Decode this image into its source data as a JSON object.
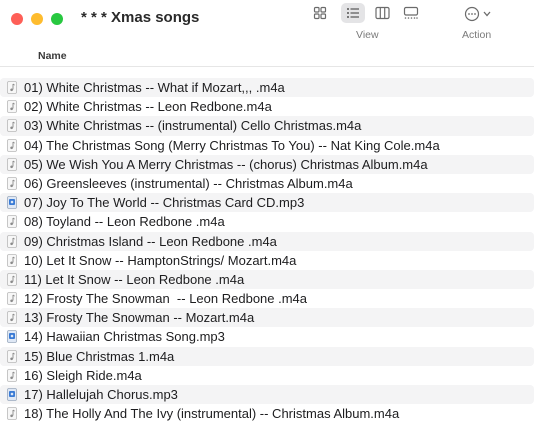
{
  "window": {
    "title": "* * * Xmas songs"
  },
  "toolbar": {
    "view_label": "View",
    "action_label": "Action"
  },
  "columns": {
    "name": "Name"
  },
  "files": [
    {
      "name": "01) White Christmas -- What if Mozart,,, .m4a",
      "kind": "m4a"
    },
    {
      "name": "02) White Christmas -- Leon Redbone.m4a",
      "kind": "m4a"
    },
    {
      "name": "03) White Christmas -- (instrumental) Cello Christmas.m4a",
      "kind": "m4a"
    },
    {
      "name": "04) The Christmas Song (Merry Christmas To You) -- Nat King Cole.m4a",
      "kind": "m4a"
    },
    {
      "name": "05) We Wish You A Merry Christmas -- (chorus) Christmas Album.m4a",
      "kind": "m4a"
    },
    {
      "name": "06) Greensleeves (instrumental) -- Christmas Album.m4a",
      "kind": "m4a"
    },
    {
      "name": "07) Joy To The World -- Christmas Card CD.mp3",
      "kind": "mp3"
    },
    {
      "name": "08) Toyland -- Leon Redbone .m4a",
      "kind": "m4a"
    },
    {
      "name": "09) Christmas Island -- Leon Redbone .m4a",
      "kind": "m4a"
    },
    {
      "name": "10) Let It Snow -- HamptonStrings/ Mozart.m4a",
      "kind": "m4a"
    },
    {
      "name": "11) Let It Snow -- Leon Redbone .m4a",
      "kind": "m4a"
    },
    {
      "name": "12) Frosty The Snowman  -- Leon Redbone .m4a",
      "kind": "m4a"
    },
    {
      "name": "13) Frosty The Snowman -- Mozart.m4a",
      "kind": "m4a"
    },
    {
      "name": "14) Hawaiian Christmas Song.mp3",
      "kind": "mp3"
    },
    {
      "name": "15) Blue Christmas 1.m4a",
      "kind": "m4a"
    },
    {
      "name": "16) Sleigh Ride.m4a",
      "kind": "m4a"
    },
    {
      "name": "17) Hallelujah Chorus.mp3",
      "kind": "mp3"
    },
    {
      "name": "18) The Holly And The Ivy (instrumental) -- Christmas Album.m4a",
      "kind": "m4a"
    }
  ],
  "colors": {
    "close": "#fe5f57",
    "minimize": "#febc2e",
    "zoom": "#28c840",
    "row_alt": "#f4f4f5",
    "mp3_icon": "#3a7bd5"
  }
}
